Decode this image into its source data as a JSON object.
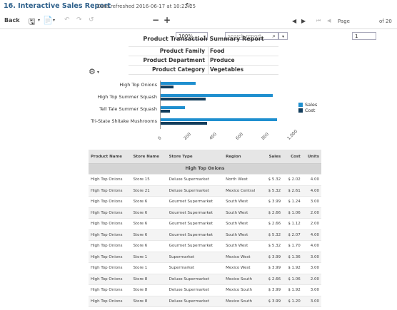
{
  "header": {
    "title": "16. Interactive Sales Report",
    "refresh_text": "Data refreshed 2016-06-17 at 10:22:25"
  },
  "toolbar": {
    "back_label": "Back",
    "zoom_value": "100%",
    "search_placeholder": "search report",
    "page_label": "Page",
    "page_value": "1",
    "page_total": "of 20"
  },
  "summary": {
    "title": "Product Transaction Summary Report",
    "rows": [
      {
        "label": "Product Family",
        "value": "Food"
      },
      {
        "label": "Product Department",
        "value": "Produce"
      },
      {
        "label": "Product Category",
        "value": "Vegetables"
      }
    ]
  },
  "chart_data": {
    "type": "bar",
    "orientation": "horizontal",
    "categories": [
      "High Top Onions",
      "High Top Summer Squash",
      "Tell Tale Summer Squash",
      "Tri-State Shitake Mushrooms"
    ],
    "series": [
      {
        "name": "Sales",
        "color": "#1f8fcf",
        "values": [
          270,
          870,
          190,
          900
        ]
      },
      {
        "name": "Cost",
        "color": "#133d5c",
        "values": [
          100,
          350,
          70,
          360
        ]
      }
    ],
    "xticks": [
      "0",
      "200",
      "400",
      "600",
      "800",
      "1,000"
    ],
    "xlim": [
      0,
      1000
    ],
    "legend": "right"
  },
  "table": {
    "columns": [
      "Product Name",
      "Store Name",
      "Store Type",
      "Region",
      "Sales",
      "Cost",
      "Units"
    ],
    "group_label": "High Top Onions",
    "rows": [
      [
        "High Top Onions",
        "Store 15",
        "Deluxe Supermarket",
        "North West",
        "$ 5.32",
        "$ 2.02",
        "4.00"
      ],
      [
        "High Top Onions",
        "Store 21",
        "Deluxe Supermarket",
        "Mexico Central",
        "$ 5.32",
        "$ 2.61",
        "4.00"
      ],
      [
        "High Top Onions",
        "Store 6",
        "Gourmet Supermarket",
        "South West",
        "$ 3.99",
        "$ 1.24",
        "3.00"
      ],
      [
        "High Top Onions",
        "Store 6",
        "Gourmet Supermarket",
        "South West",
        "$ 2.66",
        "$ 1.06",
        "2.00"
      ],
      [
        "High Top Onions",
        "Store 6",
        "Gourmet Supermarket",
        "South West",
        "$ 2.66",
        "$ 1.12",
        "2.00"
      ],
      [
        "High Top Onions",
        "Store 6",
        "Gourmet Supermarket",
        "South West",
        "$ 5.32",
        "$ 2.07",
        "4.00"
      ],
      [
        "High Top Onions",
        "Store 6",
        "Gourmet Supermarket",
        "South West",
        "$ 5.32",
        "$ 1.70",
        "4.00"
      ],
      [
        "High Top Onions",
        "Store 1",
        "Supermarket",
        "Mexico West",
        "$ 3.99",
        "$ 1.36",
        "3.00"
      ],
      [
        "High Top Onions",
        "Store 1",
        "Supermarket",
        "Mexico West",
        "$ 3.99",
        "$ 1.92",
        "3.00"
      ],
      [
        "High Top Onions",
        "Store 8",
        "Deluxe Supermarket",
        "Mexico South",
        "$ 2.66",
        "$ 1.06",
        "2.00"
      ],
      [
        "High Top Onions",
        "Store 8",
        "Deluxe Supermarket",
        "Mexico South",
        "$ 3.99",
        "$ 1.92",
        "3.00"
      ],
      [
        "High Top Onions",
        "Store 8",
        "Deluxe Supermarket",
        "Mexico South",
        "$ 3.99",
        "$ 1.20",
        "3.00"
      ]
    ]
  }
}
